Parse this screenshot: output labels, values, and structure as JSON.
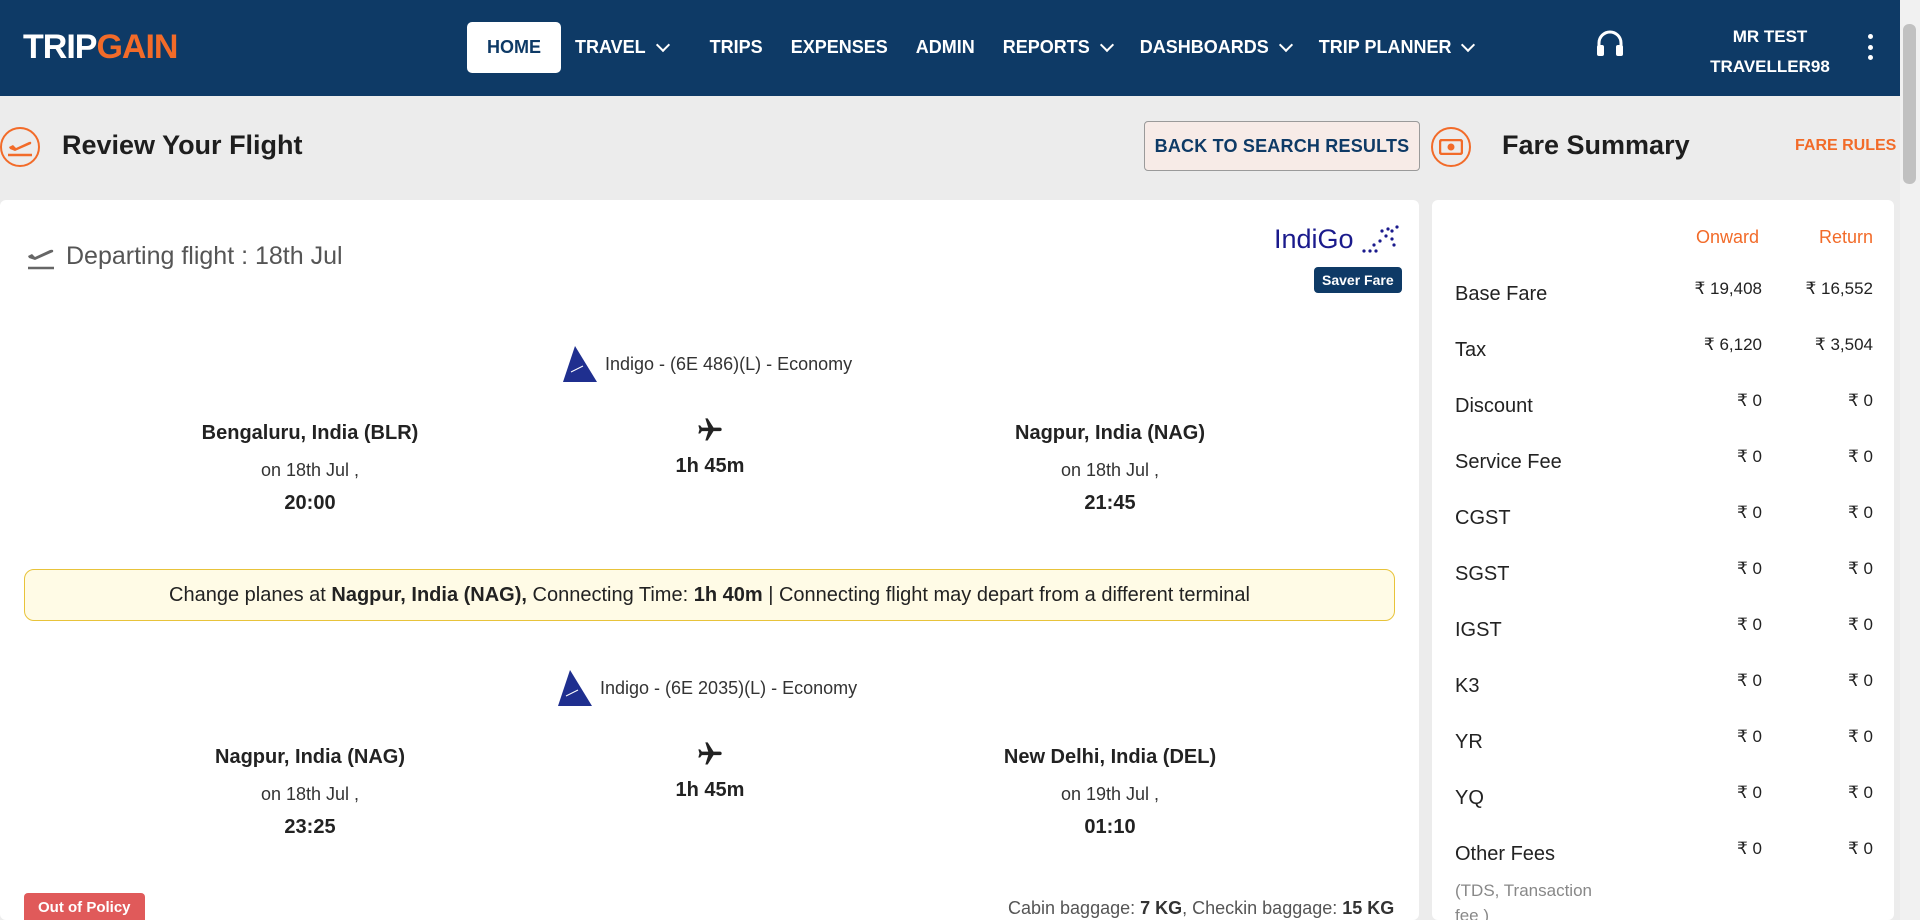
{
  "app": {
    "logo_trip": "TRIP",
    "logo_gain": "GAIN"
  },
  "nav": {
    "items": [
      {
        "label": "HOME",
        "dropdown": false,
        "active": true
      },
      {
        "label": "TRAVEL",
        "dropdown": true
      },
      {
        "label": "TRIPS",
        "dropdown": false
      },
      {
        "label": "EXPENSES",
        "dropdown": false
      },
      {
        "label": "ADMIN",
        "dropdown": false
      },
      {
        "label": "REPORTS",
        "dropdown": true
      },
      {
        "label": "DASHBOARDS",
        "dropdown": true
      },
      {
        "label": "TRIP PLANNER",
        "dropdown": true
      }
    ],
    "user_line1": "MR TEST",
    "user_line2": "TRAVELLER98"
  },
  "page": {
    "title": "Review Your Flight",
    "back_button": "BACK TO SEARCH RESULTS",
    "fare_title": "Fare Summary",
    "fare_rules": "FARE RULES"
  },
  "flight": {
    "departing_label": "Departing flight : 18th Jul",
    "airline_logo_text": "IndiGo",
    "fare_type": "Saver Fare",
    "segments": [
      {
        "carrier": "Indigo - (6E 486)(L) - Economy",
        "from_city": "Bengaluru, India (BLR)",
        "from_date": "on 18th Jul ,",
        "from_time": "20:00",
        "duration": "1h 45m",
        "to_city": "Nagpur, India (NAG)",
        "to_date": "on 18th Jul ,",
        "to_time": "21:45"
      },
      {
        "carrier": "Indigo - (6E 2035)(L) - Economy",
        "from_city": "Nagpur, India (NAG)",
        "from_date": "on 18th Jul ,",
        "from_time": "23:25",
        "duration": "1h 45m",
        "to_city": "New Delhi, India (DEL)",
        "to_date": "on 19th Jul ,",
        "to_time": "01:10"
      }
    ],
    "connection": {
      "prefix": "Change planes at",
      "city": "Nagpur, India (NAG),",
      "time_label": "Connecting Time:",
      "time": "1h 40m",
      "note": "| Connecting flight may depart from a different terminal"
    },
    "policy_badge": "Out of Policy",
    "baggage": {
      "cabin_label": "Cabin baggage:",
      "cabin": "7 KG",
      "checkin_label": ", Checkin baggage:",
      "checkin": "15 KG"
    }
  },
  "fare": {
    "onward_label": "Onward",
    "return_label": "Return",
    "rows": [
      {
        "label": "Base Fare",
        "onward": "₹ 19,408",
        "return": "₹ 16,552"
      },
      {
        "label": "Tax",
        "onward": "₹ 6,120",
        "return": "₹ 3,504"
      },
      {
        "label": "Discount",
        "onward": "₹ 0",
        "return": "₹ 0"
      },
      {
        "label": "Service Fee",
        "onward": "₹ 0",
        "return": "₹ 0"
      },
      {
        "label": "CGST",
        "onward": "₹ 0",
        "return": "₹ 0"
      },
      {
        "label": "SGST",
        "onward": "₹ 0",
        "return": "₹ 0"
      },
      {
        "label": "IGST",
        "onward": "₹ 0",
        "return": "₹ 0"
      },
      {
        "label": "K3",
        "onward": "₹ 0",
        "return": "₹ 0"
      },
      {
        "label": "YR",
        "onward": "₹ 0",
        "return": "₹ 0"
      },
      {
        "label": "YQ",
        "onward": "₹ 0",
        "return": "₹ 0"
      },
      {
        "label": "Other Fees",
        "onward": "₹ 0",
        "return": "₹ 0"
      }
    ],
    "other_note_line1": "(TDS, Transaction",
    "other_note_line2": "fee )"
  },
  "colors": {
    "navy": "#0e3a66",
    "orange": "#f26b29",
    "red_badge": "#e05a5a"
  }
}
